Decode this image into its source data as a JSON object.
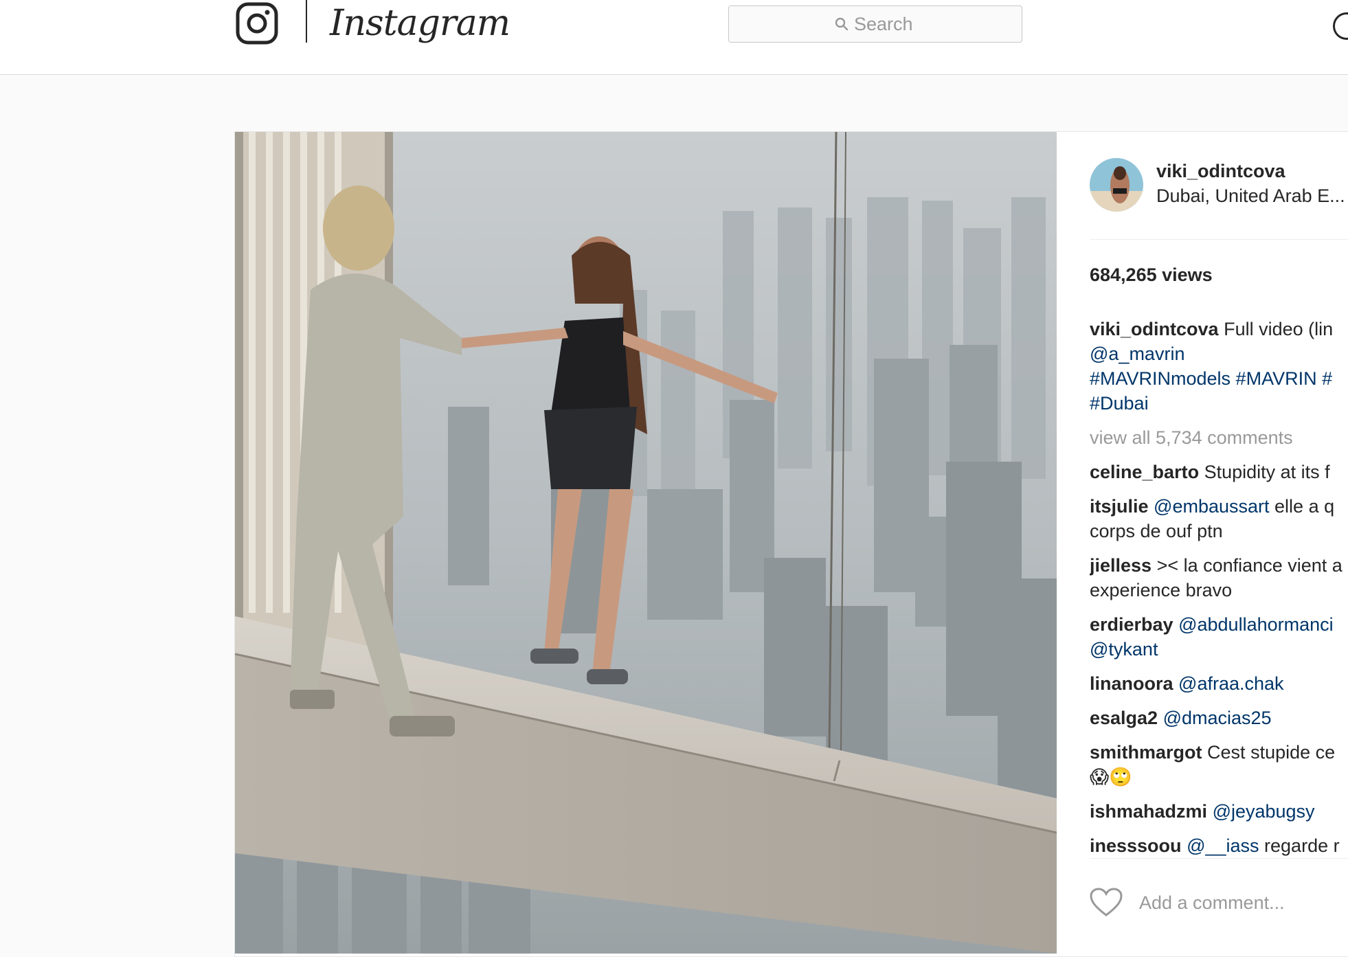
{
  "header": {
    "wordmark": "Instagram",
    "search_placeholder": "Search",
    "icons": {
      "logo": "camera-glyph-icon",
      "search": "magnifier-icon",
      "explore": "compass-icon"
    }
  },
  "post": {
    "username": "viki_odintcova",
    "location": "Dubai, United Arab E...",
    "views": "684,265 views",
    "caption": {
      "user": "viki_odintcova",
      "text": "Full video (lin",
      "lines": [
        "@a_mavrin",
        "#MAVRINmodels #MAVRIN #",
        "#Dubai"
      ]
    },
    "view_all": "view all 5,734 comments",
    "comments": [
      {
        "user": "celine_barto",
        "parts": [
          {
            "t": "Stupidity at its f"
          }
        ]
      },
      {
        "user": "itsjulie",
        "parts": [
          {
            "m": "@embaussart"
          },
          {
            "t": " elle a q\ncorps de ouf ptn"
          }
        ]
      },
      {
        "user": "jielless",
        "parts": [
          {
            "t": ">< la confiance vient a\nexperience bravo"
          }
        ]
      },
      {
        "user": "erdierbay",
        "parts": [
          {
            "m": "@abdullahormanci"
          },
          {
            "t": "\n"
          },
          {
            "m": "@tykant"
          }
        ]
      },
      {
        "user": "linanoora",
        "parts": [
          {
            "m": "@afraa.chak"
          }
        ]
      },
      {
        "user": "esalga2",
        "parts": [
          {
            "m": "@dmacias25"
          }
        ]
      },
      {
        "user": "smithmargot",
        "parts": [
          {
            "t": "Cest stupide ce\n😱🙄"
          }
        ]
      },
      {
        "user": "ishmahadzmi",
        "parts": [
          {
            "m": "@jeyabugsy"
          }
        ]
      },
      {
        "user": "inesssoou",
        "parts": [
          {
            "m": "@__iass"
          },
          {
            "t": " regarde r"
          }
        ]
      }
    ],
    "add_comment_placeholder": "Add a comment...",
    "like_icon": "heart-icon"
  },
  "colors": {
    "link": "#003569",
    "muted": "#999999",
    "text": "#262626",
    "border": "#dbdbdb"
  }
}
